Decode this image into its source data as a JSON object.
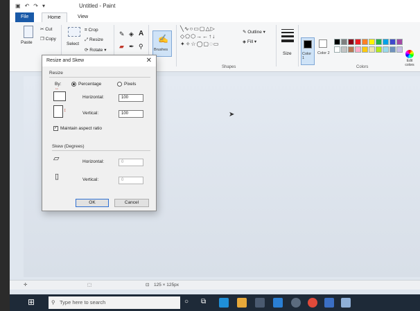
{
  "window": {
    "title": "Untitled - Paint"
  },
  "tabs": [
    {
      "label": "File"
    },
    {
      "label": "Home"
    },
    {
      "label": "View"
    }
  ],
  "ribbon": {
    "clipboard": {
      "paste": "Paste",
      "cut": "Cut",
      "copy": "Copy"
    },
    "image": {
      "select": "Select",
      "crop": "Crop",
      "resize": "Resize",
      "rotate": "Rotate"
    },
    "brushes": "Brushes",
    "shapes": {
      "group": "Shapes",
      "outline": "Outline",
      "fill": "Fill"
    },
    "size": "Size",
    "colors": {
      "color1": "Color 1",
      "color2": "Color 2",
      "group": "Colors",
      "edit": "Edit colors"
    },
    "palette_top": [
      "#000000",
      "#7f7f7f",
      "#880015",
      "#ed1c24",
      "#ff7f27",
      "#fff200",
      "#22b14c",
      "#00a2e8",
      "#3f48cc",
      "#a349a4"
    ],
    "palette_bottom": [
      "#ffffff",
      "#c3c3c3",
      "#b97a57",
      "#ffaec9",
      "#ffc90e",
      "#efe4b0",
      "#b5e61d",
      "#99d9ea",
      "#7092be",
      "#c8bfe7"
    ]
  },
  "dialog": {
    "title": "Resize and Skew",
    "resize_section": "Resize",
    "by_label": "By:",
    "percentage_label": "Percentage",
    "pixels_label": "Pixels",
    "horizontal_label": "Horizontal:",
    "horizontal_value": "100",
    "vertical_label": "Vertical:",
    "vertical_value": "100",
    "maintain_label": "Maintain aspect ratio",
    "skew_section": "Skew (Degrees)",
    "skew_horizontal_label": "Horizontal:",
    "skew_horizontal_value": "0",
    "skew_vertical_label": "Vertical:",
    "skew_vertical_value": "0",
    "ok_label": "OK",
    "cancel_label": "Cancel"
  },
  "statusbar": {
    "dimensions": "125 × 125px"
  },
  "taskbar": {
    "search_placeholder": "Type here to search"
  }
}
